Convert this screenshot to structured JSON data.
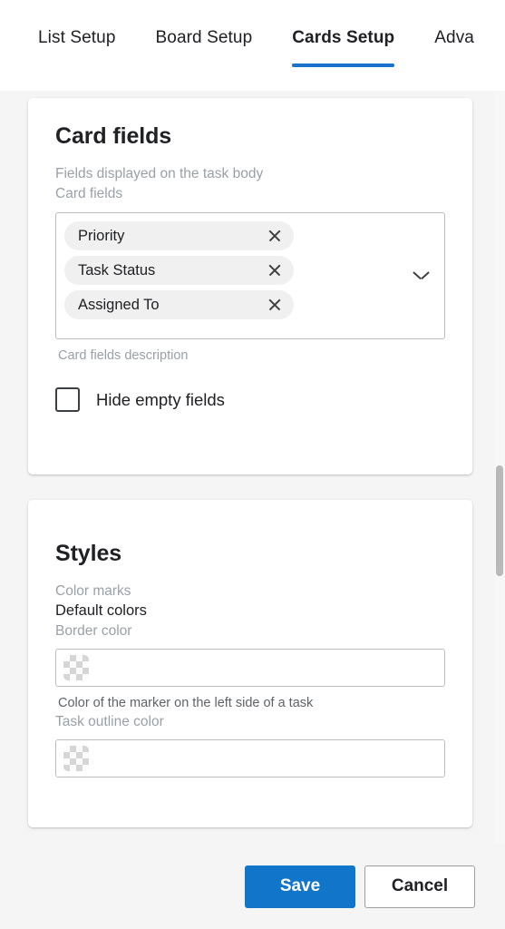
{
  "tabs": [
    {
      "label": "List Setup",
      "active": false
    },
    {
      "label": "Board Setup",
      "active": false
    },
    {
      "label": "Cards Setup",
      "active": true
    },
    {
      "label": "Adva",
      "active": false
    }
  ],
  "card_fields": {
    "title": "Card fields",
    "description": "Fields displayed on the task body",
    "select_label": "Card fields",
    "chips": [
      {
        "label": "Priority",
        "remove_icon": "close-icon"
      },
      {
        "label": "Task Status",
        "remove_icon": "close-icon"
      },
      {
        "label": "Assigned To",
        "remove_icon": "close-icon"
      }
    ],
    "dropdown_icon": "chevron-down-icon",
    "helper": "Card fields description",
    "hide_empty_fields": {
      "label": "Hide empty fields",
      "checked": false
    }
  },
  "styles": {
    "title": "Styles",
    "color_marks_label": "Color marks",
    "color_marks_value": "Default colors",
    "border_color": {
      "label": "Border color",
      "swatch": "transparent-checkerboard",
      "helper": "Color of the marker on the left side of a task"
    },
    "task_outline_color": {
      "label": "Task outline color",
      "swatch": "transparent-checkerboard"
    }
  },
  "footer": {
    "save_label": "Save",
    "cancel_label": "Cancel"
  },
  "colors": {
    "accent": "#1176ca",
    "tab_underline": "#1a73c8",
    "page_background": "#f5f5f5",
    "card_background": "#ffffff",
    "muted_text": "#9aa0a6",
    "primary_text": "#202124",
    "chip_background": "#f0f0f0"
  }
}
